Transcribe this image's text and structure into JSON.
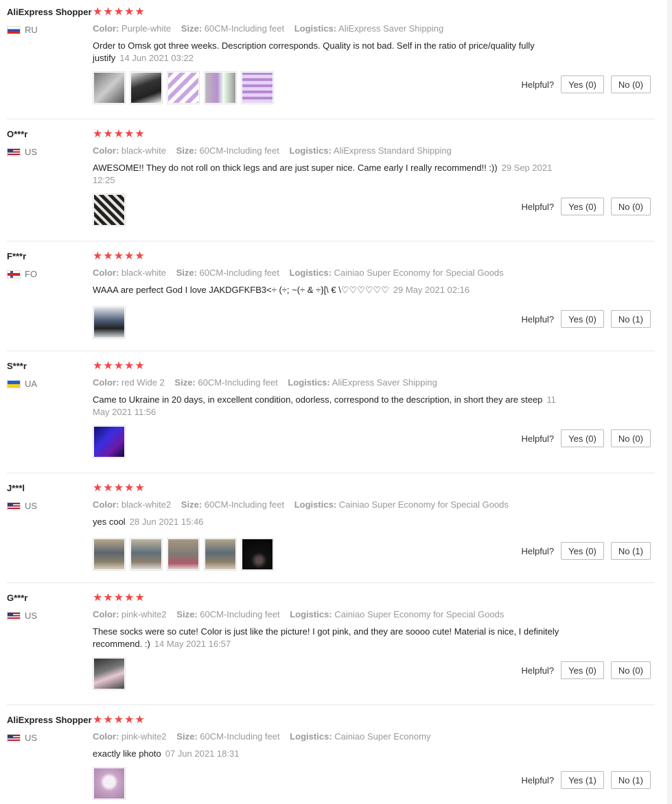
{
  "labels": {
    "color": "Color:",
    "size": "Size:",
    "logistics": "Logistics:",
    "helpful": "Helpful?"
  },
  "rating_color": "#f44646",
  "reviews": [
    {
      "user": "AliExpress Shopper",
      "country": "RU",
      "flag": "flag-ru",
      "rating": 5,
      "stars": "★★★★★",
      "color": "Purple-white",
      "size": "60CM-Including feet",
      "logistics": "AliExpress Saver Shipping",
      "text": "Order to Omsk got three weeks. Description corresponds. Quality is not bad. Self in the ratio of price/quality fully justify",
      "date": "14 Jun 2021 03:22",
      "photos": [
        {
          "name": "photo-purple-socks-on-bed",
          "bg": "linear-gradient(135deg,#777,#ccc 50%,#555)"
        },
        {
          "name": "photo-dark-socks-package",
          "bg": "linear-gradient(160deg,#ddd,#333 40%,#222 70%,#eee)"
        },
        {
          "name": "photo-purple-striped-socks",
          "bg": "repeating-linear-gradient(135deg,#c9a6e0 0 6px,#fff 6px 12px)"
        },
        {
          "name": "photo-purple-socks-stack",
          "bg": "linear-gradient(90deg,#bbb,#b88fd0 40%,#efe 60%,#999)"
        },
        {
          "name": "photo-purple-socks-folded",
          "bg": "repeating-linear-gradient(0deg,#e7d3f2 0 5px,#b48ad4 5px 9px)"
        }
      ],
      "yes": "Yes (0)",
      "no": "No (0)"
    },
    {
      "user": "O***r",
      "country": "US",
      "flag": "flag-us",
      "rating": 5,
      "stars": "★★★★★",
      "color": "black-white",
      "size": "60CM-Including feet",
      "logistics": "AliExpress Standard Shipping",
      "text": "AWESOME!! They do not roll on thick legs and are just super nice. Came early I really recommend!! :))",
      "date": "29 Sep 2021 12:25",
      "photos": [
        {
          "name": "photo-striped-socks-legs",
          "bg": "repeating-linear-gradient(45deg,#222 0 5px,#e8e2dc 5px 9px)"
        }
      ],
      "yes": "Yes (0)",
      "no": "No (0)"
    },
    {
      "user": "F***r",
      "country": "FO",
      "flag": "flag-fo",
      "rating": 5,
      "stars": "★★★★★",
      "color": "black-white",
      "size": "60CM-Including feet",
      "logistics": "Cainiao Super Economy for Special Goods",
      "text": "WAAA are perfect God I love JAKDGFKFB3<÷ (÷; ~(÷ & ÷}[\\ € \\♡♡♡♡♡♡",
      "date": "29 May 2021 02:16",
      "photos": [
        {
          "name": "photo-socks-on-floor",
          "bg": "linear-gradient(180deg,#dfe3e8,#4a5a72 45%,#222 70%,#cfd5dc)"
        }
      ],
      "yes": "Yes (0)",
      "no": "No (1)"
    },
    {
      "user": "S***r",
      "country": "UA",
      "flag": "flag-ua",
      "rating": 5,
      "stars": "★★★★★",
      "color": "red Wide 2",
      "size": "60CM-Including feet",
      "logistics": "AliExpress Saver Shipping",
      "text": "Came to Ukraine in 20 days, in excellent condition, odorless, correspond to the description, in short they are steep",
      "date": "11 May 2021 11:56",
      "photos": [
        {
          "name": "photo-blue-lit-socks",
          "bg": "linear-gradient(135deg,#101070,#3a2ee0 40%,#6b1aa8 70%,#0a0a40)"
        }
      ],
      "yes": "Yes (0)",
      "no": "No (0)"
    },
    {
      "user": "J***l",
      "country": "US",
      "flag": "flag-us",
      "rating": 5,
      "stars": "★★★★★",
      "color": "black-white2",
      "size": "60CM-Including feet",
      "logistics": "Cainiao Super Economy for Special Goods",
      "text": "yes cool",
      "date": "28 Jun 2021 15:46",
      "photos": [
        {
          "name": "photo-legs-in-socks-1",
          "bg": "linear-gradient(180deg,#b8a88a,#5c6470 45%,#8a7f6a 75%,#d8d0c0)"
        },
        {
          "name": "photo-legs-in-socks-2",
          "bg": "linear-gradient(180deg,#c0b5a0,#60707c 45%,#8b806d 75%,#ddd)"
        },
        {
          "name": "photo-legs-in-socks-3",
          "bg": "linear-gradient(180deg,#a89884,#7e7a74 50%,#b05a6a 80%,#e0d8d0)"
        },
        {
          "name": "photo-legs-in-socks-4",
          "bg": "linear-gradient(180deg,#b5a58a,#5d6b78 45%,#8d8069 75%,#d6cdb8)"
        },
        {
          "name": "photo-socks-dark-room",
          "bg": "radial-gradient(circle at 55% 70%,#5a4a4a 0 10%,#111 30%,#050505)"
        }
      ],
      "yes": "Yes (0)",
      "no": "No (1)"
    },
    {
      "user": "G***r",
      "country": "US",
      "flag": "flag-us",
      "rating": 5,
      "stars": "★★★★★",
      "color": "pink-white2",
      "size": "60CM-Including feet",
      "logistics": "Cainiao Super Economy for Special Goods",
      "text": "These socks were so cute! Color is just like the picture! I got pink, and they are soooo cute! Material is nice, I definitely recommend. :)",
      "date": "14 May 2021 16:57",
      "photos": [
        {
          "name": "photo-pink-socks-feet",
          "bg": "linear-gradient(160deg,#333,#777 40%,#e6c8d2 60%,#444)"
        }
      ],
      "yes": "Yes (0)",
      "no": "No (0)"
    },
    {
      "user": "AliExpress Shopper",
      "country": "US",
      "flag": "flag-us",
      "rating": 5,
      "stars": "★★★★★",
      "color": "pink-white2",
      "size": "60CM-Including feet",
      "logistics": "Cainiao Super Economy",
      "text": "exactly like photo",
      "date": "07 Jun 2021 18:31",
      "photos": [
        {
          "name": "photo-pink-character-socks",
          "bg": "radial-gradient(circle at 50% 45%,#f5eef5 0 25%,#c9a6c9 40%,#a882a8)"
        }
      ],
      "yes": "Yes (1)",
      "no": "No (1)"
    }
  ]
}
